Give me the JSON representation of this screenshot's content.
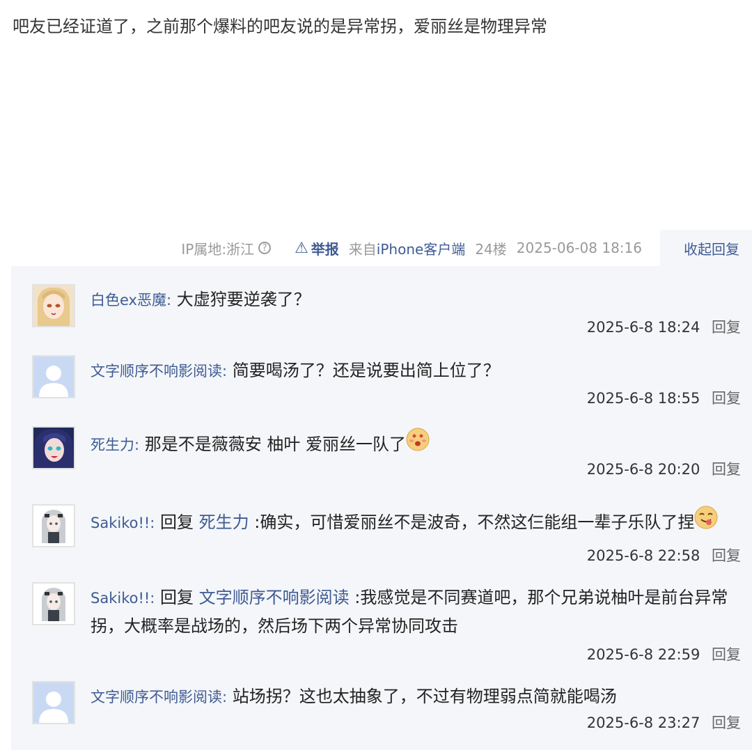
{
  "post": {
    "text": "吧友已经证道了，之前那个爆料的吧友说的是异常拐，爱丽丝是物理异常",
    "meta": {
      "ip_label": "IP属地:浙江",
      "report_label": "举报",
      "source_prefix": "来自",
      "source_client": "iPhone客户端",
      "floor": "24楼",
      "datetime": "2025-06-08 18:16",
      "collapse_label": "收起回复"
    }
  },
  "icons": {
    "help": "question-circle-icon",
    "report": "warning-triangle-icon",
    "emoji_blush": "blush-emoji-icon",
    "emoji_tongue": "tongue-emoji-icon"
  },
  "colors": {
    "link": "#3f5b93",
    "reply_bg": "#f4f6f9",
    "meta_gray": "#999999"
  },
  "replies": [
    {
      "username": "白色ex恶魔",
      "separator": ":",
      "text": "大虚狩要逆袭了？",
      "time": "2025-6-8 18:24",
      "reply_label": "回复"
    },
    {
      "username": "文字顺序不响影阅读",
      "separator": ":",
      "text": "简要喝汤了？还是说要出简上位了？",
      "time": "2025-6-8 18:55",
      "reply_label": "回复"
    },
    {
      "username": "死生力",
      "separator": ":",
      "text": "那是不是薇薇安 柚叶 爱丽丝一队了",
      "time": "2025-6-8 20:20",
      "reply_label": "回复"
    },
    {
      "username": "Sakiko!!",
      "separator": ":",
      "reply_word": "回复",
      "mention": "死生力",
      "text": ":确实，可惜爱丽丝不是波奇，不然这仨能组一辈子乐队了捏",
      "time": "2025-6-8 22:58",
      "reply_label": "回复"
    },
    {
      "username": "Sakiko!!",
      "separator": ":",
      "reply_word": "回复",
      "mention": "文字顺序不响影阅读",
      "text": ":我感觉是不同赛道吧，那个兄弟说柚叶是前台异常拐，大概率是战场的，然后场下两个异常协同攻击",
      "time": "2025-6-8 22:59",
      "reply_label": "回复"
    },
    {
      "username": "文字顺序不响影阅读",
      "separator": ":",
      "text": "站场拐？这也太抽象了，不过有物理弱点简就能喝汤",
      "time": "2025-6-8 23:27",
      "reply_label": "回复"
    }
  ]
}
